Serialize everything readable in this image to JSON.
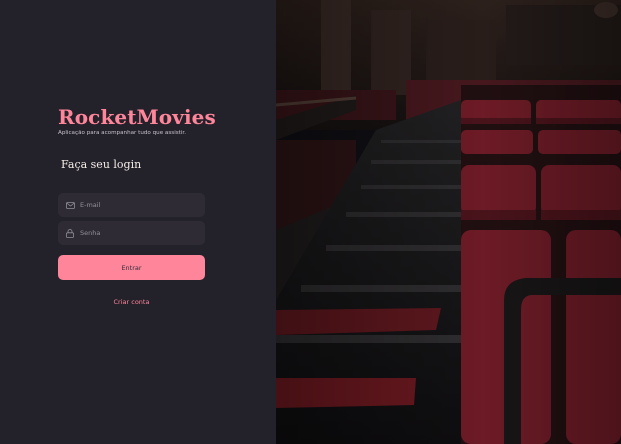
{
  "brand": {
    "title": "RocketMovies",
    "tagline": "Aplicação para acompanhar tudo que assistir."
  },
  "form": {
    "title": "Faça seu login",
    "email": {
      "placeholder": "E-mail",
      "icon": "mail-icon"
    },
    "password": {
      "placeholder": "Senha",
      "icon": "lock-icon"
    },
    "submit_label": "Entrar",
    "create_account_label": "Criar conta"
  },
  "colors": {
    "accent": "#ff859b",
    "panel_bg": "#232129",
    "input_bg": "#2e2b35",
    "placeholder": "#948f99",
    "text": "#f4ede8"
  },
  "background_image": {
    "description_icon": "cinema-theater-image"
  }
}
